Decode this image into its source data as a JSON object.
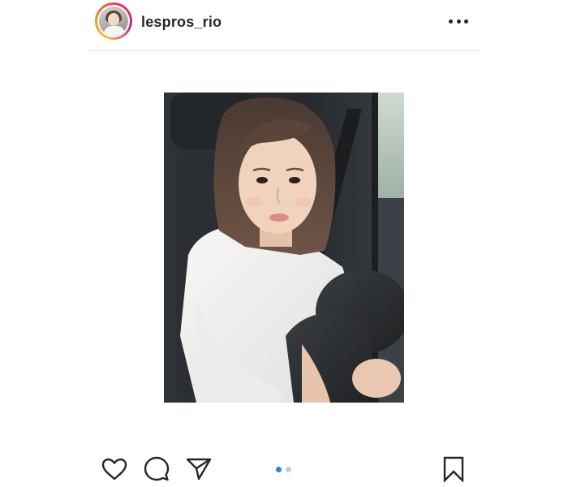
{
  "post": {
    "username": "lespros_rio",
    "avatar_icon": "profile-avatar",
    "more_icon": "more-horizontal-icon",
    "image": {
      "description_icon": "post-photo"
    }
  },
  "actions": {
    "like_icon": "heart-icon",
    "comment_icon": "comment-icon",
    "share_icon": "paper-plane-icon",
    "save_icon": "bookmark-icon"
  },
  "carousel": {
    "total": 2,
    "active_index": 0,
    "active_color": "#1a8cf0",
    "inactive_color": "#c9c9c9"
  },
  "colors": {
    "text": "#262626",
    "divider": "#e6e6e6",
    "story_ring": [
      "#f9c043",
      "#f08a2a",
      "#e0336f",
      "#b8309a"
    ]
  }
}
